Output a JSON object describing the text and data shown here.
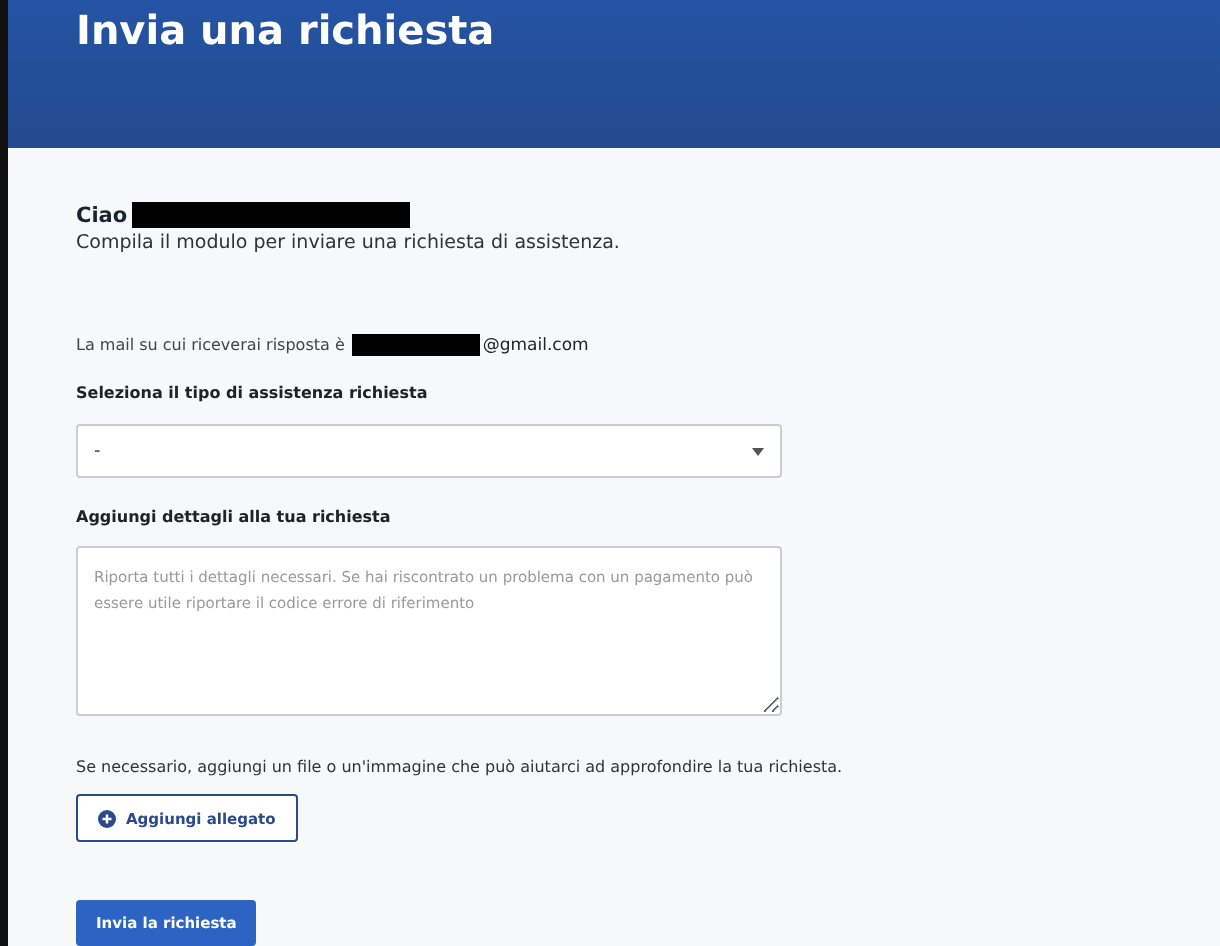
{
  "header": {
    "title": "Invia una richiesta"
  },
  "greeting": {
    "label": "Ciao",
    "redacted": true
  },
  "intro": "Compila il modulo per inviare una richiesta di assistenza.",
  "email_line": {
    "label": "La mail su cui riceverai risposta è",
    "redacted": true,
    "domain": "@gmail.com"
  },
  "type_field": {
    "label": "Seleziona il tipo di assistenza richiesta",
    "value": "-"
  },
  "details_field": {
    "label": "Aggiungi dettagli alla tua richiesta",
    "placeholder": "Riporta tutti i dettagli necessari. Se hai riscontrato un problema con un pagamento può essere utile riportare il codice errore di riferimento"
  },
  "attachment_hint": "Se necessario, aggiungi un file o un'immagine che può aiutarci ad approfondire la tua richiesta.",
  "attach_button": "Aggiungi allegato",
  "submit_button": "Invia la richiesta"
}
